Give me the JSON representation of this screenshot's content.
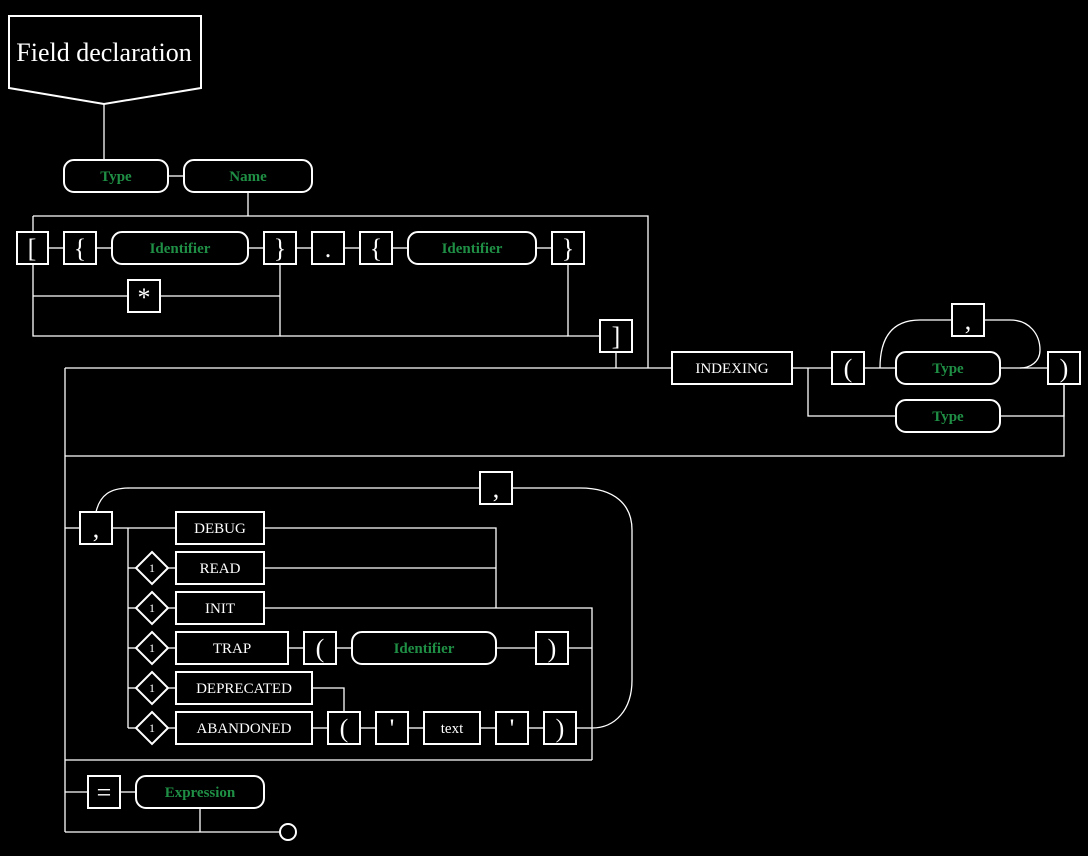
{
  "title": "Field declaration",
  "nonterminals": {
    "type": "Type",
    "name": "Name",
    "identifier": "Identifier",
    "expression": "Expression"
  },
  "keywords": {
    "indexing": "INDEXING",
    "debug": "DEBUG",
    "read": "READ",
    "init": "INIT",
    "trap": "TRAP",
    "deprecated": "DEPRECATED",
    "abandoned": "ABANDONED",
    "text": "text"
  },
  "symbols": {
    "lbracket": "[",
    "rbracket": "]",
    "lbrace": "{",
    "rbrace": "}",
    "dot": ".",
    "star": "*",
    "lparen": "(",
    "rparen": ")",
    "comma": ",",
    "quote": "'",
    "equals": "="
  },
  "repeat_limit": "1",
  "colors": {
    "background": "#000000",
    "line": "#ffffff",
    "nonterminal_text": "#1f8f45"
  }
}
